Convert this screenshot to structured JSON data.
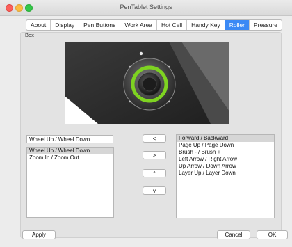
{
  "window": {
    "title": "PenTablet Settings"
  },
  "tabs": [
    {
      "label": "About",
      "active": false
    },
    {
      "label": "Display",
      "active": false
    },
    {
      "label": "Pen Buttons",
      "active": false
    },
    {
      "label": "Work Area",
      "active": false
    },
    {
      "label": "Hot Cell",
      "active": false
    },
    {
      "label": "Handy Key",
      "active": false
    },
    {
      "label": "Roller",
      "active": true
    },
    {
      "label": "Pressure",
      "active": false
    }
  ],
  "box": {
    "label": "Box"
  },
  "wheel": {
    "current_value": "Wheel Up / Wheel Down",
    "assigned": [
      {
        "label": "Wheel Up / Wheel Down",
        "selected": true
      },
      {
        "label": "Zoom In / Zoom Out",
        "selected": false
      }
    ]
  },
  "transfer": {
    "move_left": "<",
    "move_right": ">",
    "move_up": "^",
    "move_down": "v"
  },
  "available": [
    {
      "label": "Forward / Backward",
      "selected": true
    },
    {
      "label": "Page Up / Page Down",
      "selected": false
    },
    {
      "label": "Brush - / Brush +",
      "selected": false
    },
    {
      "label": "Left Arrow / Right Arrow",
      "selected": false
    },
    {
      "label": "Up Arrow / Down Arrow",
      "selected": false
    },
    {
      "label": "Layer Up / Layer Down",
      "selected": false
    }
  ],
  "footer": {
    "apply": "Apply",
    "cancel": "Cancel",
    "ok": "OK"
  },
  "colors": {
    "accent": "#3b89f5",
    "ring": "#7ed321"
  }
}
